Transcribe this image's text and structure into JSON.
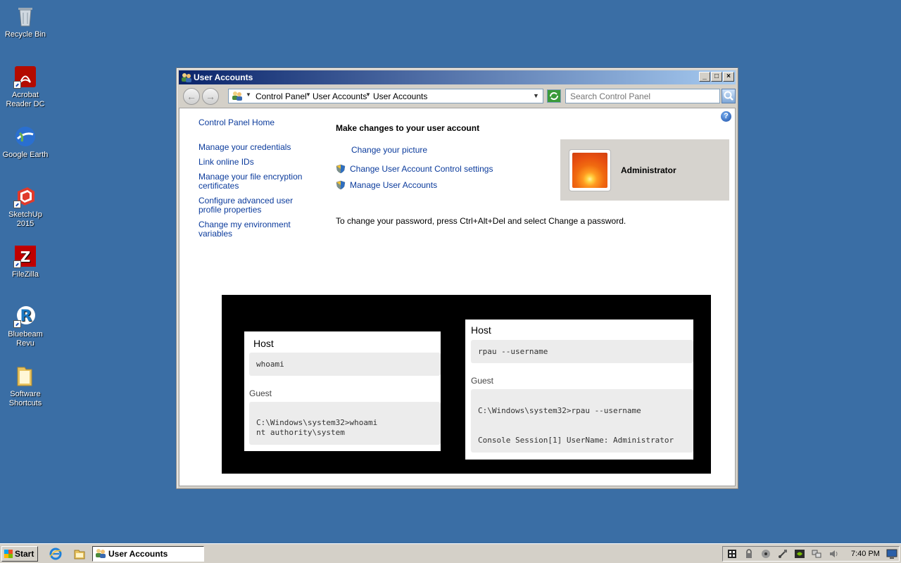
{
  "desktop": {
    "icons": [
      {
        "label": "Recycle Bin"
      },
      {
        "label": "Acrobat Reader DC"
      },
      {
        "label": "Google Earth"
      },
      {
        "label": "SketchUp 2015"
      },
      {
        "label": "FileZilla"
      },
      {
        "label": "Bluebeam Revu"
      },
      {
        "label": "Software Shortcuts"
      }
    ]
  },
  "window": {
    "title": "User Accounts",
    "breadcrumbs": [
      "Control Panel",
      "User Accounts",
      "User Accounts"
    ],
    "search_placeholder": "Search Control Panel",
    "sidebar": {
      "home": "Control Panel Home",
      "links": [
        "Manage your credentials",
        "Link online IDs",
        "Manage your file encryption certificates",
        "Configure advanced user profile properties",
        "Change my environment variables"
      ]
    },
    "main": {
      "heading": "Make changes to your user account",
      "tasks": [
        "Change your picture",
        "Change User Account Control settings",
        "Manage User Accounts"
      ],
      "account_name": "Administrator",
      "password_note": "To change your password, press Ctrl+Alt+Del and select Change a password."
    },
    "snapshot": {
      "left": {
        "host_label": "Host",
        "host_cmd": "whoami",
        "guest_label": "Guest",
        "guest_output": "C:\\Windows\\system32>whoami\nnt authority\\system"
      },
      "right": {
        "host_label": "Host",
        "host_cmd": "rpau --username",
        "guest_label": "Guest",
        "guest_output_1": "C:\\Windows\\system32>rpau --username",
        "guest_output_2": "Console Session[1] UserName: Administrator"
      }
    }
  },
  "taskbar": {
    "start_label": "Start",
    "active_task": "User Accounts",
    "clock": "7:40 PM"
  }
}
